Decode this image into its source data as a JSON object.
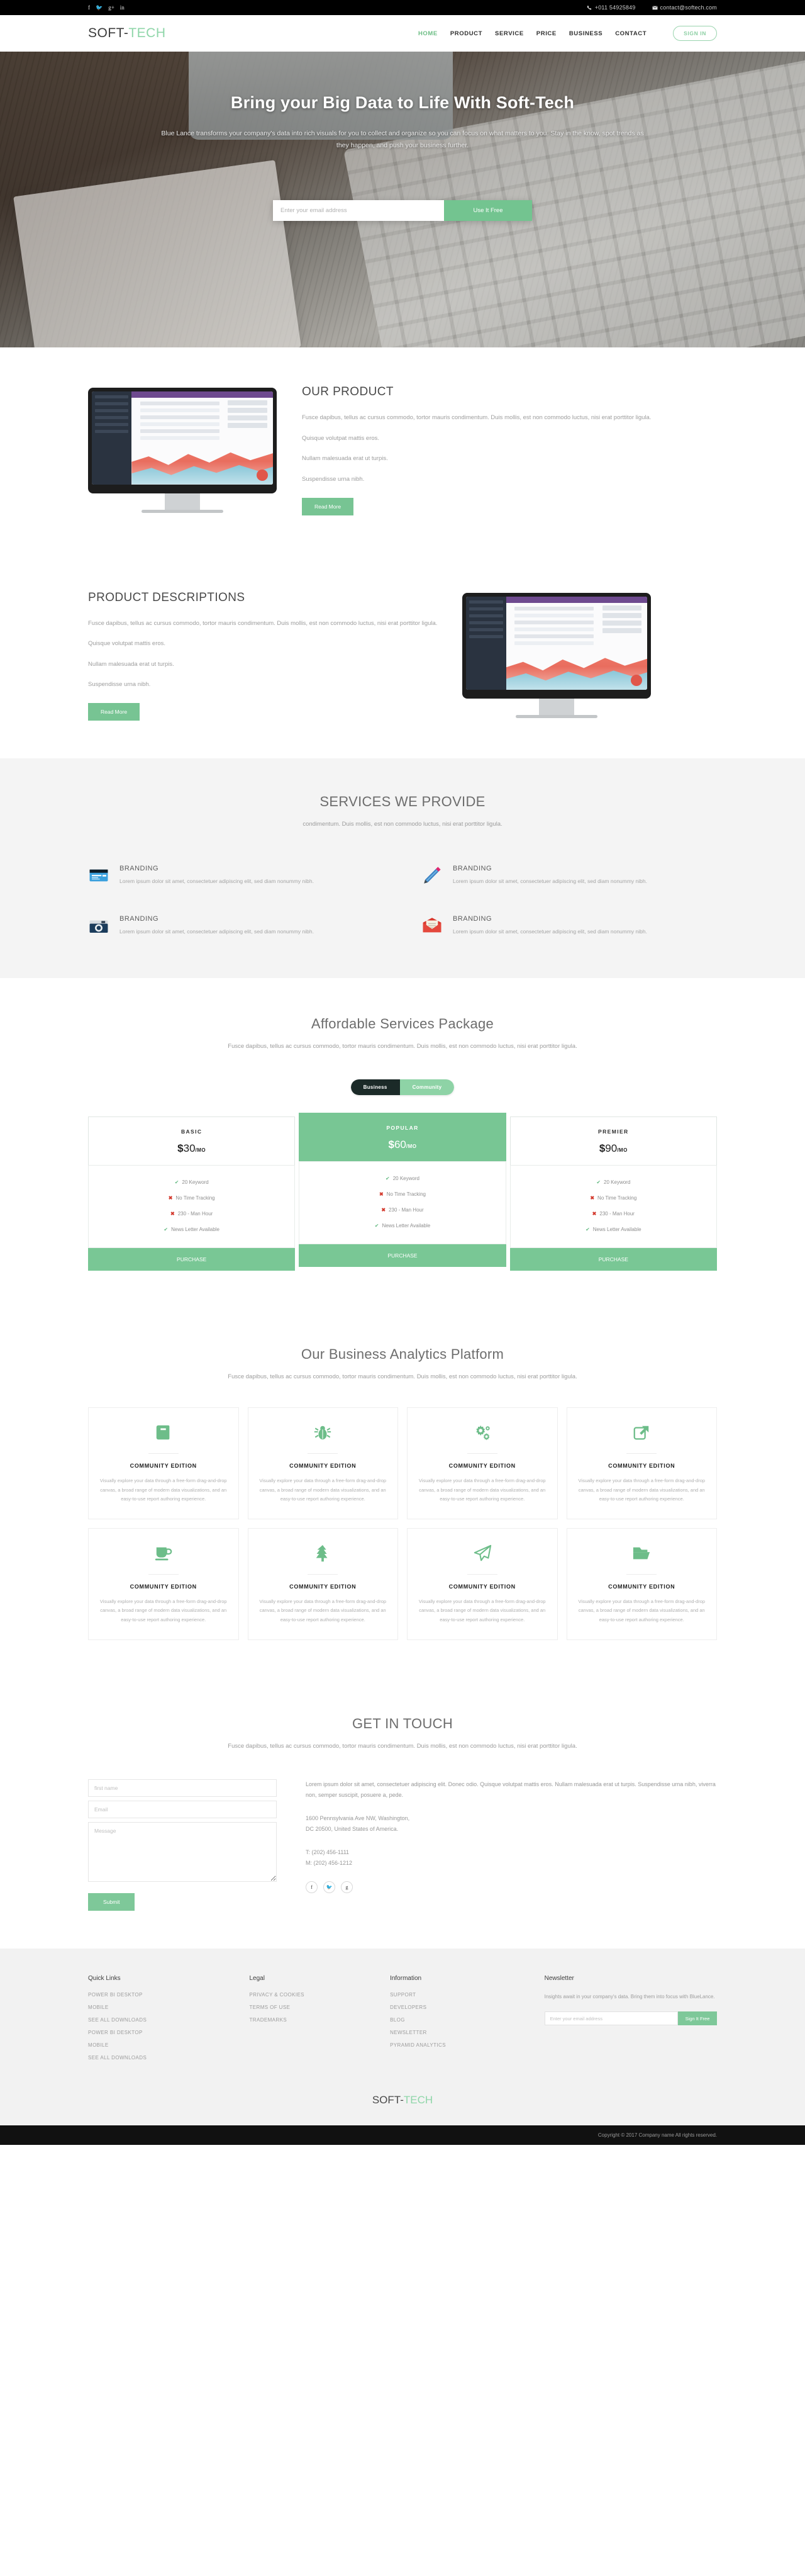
{
  "topbar": {
    "social": [
      {
        "name": "facebook-icon",
        "glyph": "f"
      },
      {
        "name": "twitter-icon",
        "glyph": "✉"
      },
      {
        "name": "google-plus-icon",
        "glyph": "g+"
      },
      {
        "name": "linkedin-icon",
        "glyph": "in"
      }
    ],
    "phone": "+011 54925849",
    "email": "contact@softech.com"
  },
  "nav": {
    "logo_main": "SOFT-",
    "logo_accent": "TECH",
    "links": [
      {
        "label": "HOME",
        "active": true
      },
      {
        "label": "PRODUCT",
        "active": false
      },
      {
        "label": "SERVICE",
        "active": false
      },
      {
        "label": "PRICE",
        "active": false
      },
      {
        "label": "BUSINESS",
        "active": false
      },
      {
        "label": "CONTACT",
        "active": false
      }
    ],
    "signin_label": "SIGN IN"
  },
  "hero": {
    "heading": "Bring your Big Data to Life With Soft-Tech",
    "paragraph": "Blue Lance transforms your company's data into rich visuals for you to collect and organize so you can focus on what matters to you. Stay in the know, spot trends as they happen, and push your business further.",
    "email_placeholder": "Enter your email address",
    "email_value": "",
    "cta_label": "Use It Free"
  },
  "product": {
    "title": "OUR PRODUCT",
    "paragraphs": [
      "Fusce dapibus, tellus ac cursus commodo, tortor mauris condimentum. Duis mollis, est non commodo luctus, nisi erat porttitor ligula.",
      "Quisque volutpat mattis eros.",
      "Nullam malesuada erat ut turpis.",
      "Suspendisse urna nibh."
    ],
    "button_label": "Read More"
  },
  "product_desc": {
    "title": "PRODUCT DESCRIPTIONS",
    "paragraphs": [
      "Fusce dapibus, tellus ac cursus commodo, tortor mauris condimentum. Duis mollis, est non commodo luctus, nisi erat porttitor ligula.",
      "Quisque volutpat mattis eros.",
      "Nullam malesuada erat ut turpis.",
      "Suspendisse urna nibh."
    ],
    "button_label": "Read More"
  },
  "services": {
    "title": "SERVICES WE PROVIDE",
    "subtitle": "condimentum. Duis mollis, est non commodo luctus, nisi erat porttitor ligula.",
    "items": [
      {
        "icon": "credit-card-icon",
        "title": "BRANDING",
        "text": "Lorem ipsum dolor sit amet, consectetuer adipiscing elit, sed diam nonummy nibh."
      },
      {
        "icon": "pencil-icon",
        "title": "BRANDING",
        "text": "Lorem ipsum dolor sit amet, consectetuer adipiscing elit, sed diam nonummy nibh."
      },
      {
        "icon": "camera-icon",
        "title": "BRANDING",
        "text": "Lorem ipsum dolor sit amet, consectetuer adipiscing elit, sed diam nonummy nibh."
      },
      {
        "icon": "envelope-icon",
        "title": "BRANDING",
        "text": "Lorem ipsum dolor sit amet, consectetuer adipiscing elit, sed diam nonummy nibh."
      }
    ]
  },
  "pricing": {
    "title": "Affordable Services Package",
    "subtitle": "Fusce dapibus, tellus ac cursus commodo, tortor mauris condimentum. Duis mollis, est non commodo luctus, nisi erat porttitor ligula.",
    "toggle": {
      "active": "Business",
      "inactive": "Community"
    },
    "accent_color": "#79c795",
    "plans": [
      {
        "name": "BASIC",
        "currency": "$",
        "amount": "30",
        "period": "/MO",
        "featured": false,
        "features": [
          {
            "ok": true,
            "label": "20 Keyword"
          },
          {
            "ok": false,
            "label": "No Time Tracking"
          },
          {
            "ok": false,
            "label": "230 - Man Hour"
          },
          {
            "ok": true,
            "label": "News Letter Available"
          }
        ],
        "cta": "PURCHASE"
      },
      {
        "name": "POPULAR",
        "currency": "$",
        "amount": "60",
        "period": "/MO",
        "featured": true,
        "features": [
          {
            "ok": true,
            "label": "20 Keyword"
          },
          {
            "ok": false,
            "label": "No Time Tracking"
          },
          {
            "ok": false,
            "label": "230 - Man Hour"
          },
          {
            "ok": true,
            "label": "News Letter Available"
          }
        ],
        "cta": "PURCHASE"
      },
      {
        "name": "PREMIER",
        "currency": "$",
        "amount": "90",
        "period": "/MO",
        "featured": false,
        "features": [
          {
            "ok": true,
            "label": "20 Keyword"
          },
          {
            "ok": false,
            "label": "No Time Tracking"
          },
          {
            "ok": false,
            "label": "230 - Man Hour"
          },
          {
            "ok": true,
            "label": "News Letter Available"
          }
        ],
        "cta": "PURCHASE"
      }
    ]
  },
  "analytics": {
    "title": "Our Business Analytics Platform",
    "subtitle": "Fusce dapibus, tellus ac cursus commodo, tortor mauris condimentum. Duis mollis, est non commodo luctus, nisi erat porttitor ligula.",
    "card_title": "COMMUNITY EDITION",
    "card_text": "Visually explore your data through a free-form drag-and-drop canvas, a broad range of modern data visualizations, and an easy-to-use report authoring experience.",
    "icons": [
      "book-icon",
      "bug-icon",
      "gears-icon",
      "external-link-icon",
      "coffee-cup-icon",
      "tree-icon",
      "paper-plane-icon",
      "folder-open-icon"
    ]
  },
  "contact": {
    "title": "GET IN TOUCH",
    "subtitle": "Fusce dapibus, tellus ac cursus commodo, tortor mauris condimentum. Duis mollis, est non commodo luctus, nisi erat porttitor ligula.",
    "form": {
      "name_placeholder": "first name",
      "name_value": "",
      "email_placeholder": "Email",
      "email_value": "",
      "message_placeholder": "Message",
      "message_value": "",
      "submit_label": "Submit"
    },
    "info_text": "Lorem ipsum dolor sit amet, consectetuer adipiscing elit. Donec odio. Quisque volutpat mattis eros. Nullam malesuada erat ut turpis. Suspendisse urna nibh, viverra non, semper suscipit, posuere a, pede.",
    "address_line1": "1600 Pennsylvania Ave NW, Washington,",
    "address_line2": "DC 20500, United States of America.",
    "tel": "T: (202) 456-1111",
    "mob": "M: (202) 456-1212",
    "social": [
      {
        "name": "facebook-icon",
        "glyph": "f"
      },
      {
        "name": "twitter-icon",
        "glyph": "✉"
      },
      {
        "name": "google-plus-icon",
        "glyph": "g"
      }
    ]
  },
  "footer": {
    "columns": [
      {
        "heading": "Quick Links",
        "links": [
          "POWER BI DESKTOP",
          "MOBILE",
          "SEE ALL DOWNLOADS",
          "POWER BI DESKTOP",
          "MOBILE",
          "SEE ALL DOWNLOADS"
        ]
      },
      {
        "heading": "Legal",
        "links": [
          "PRIVACY & COOKIES",
          "TERMS OF USE",
          "TRADEMARKS"
        ]
      },
      {
        "heading": "Information",
        "links": [
          "SUPPORT",
          "DEVELOPERS",
          "BLOG",
          "NEWSLETTER",
          "PYRAMID ANALYTICS"
        ]
      }
    ],
    "newsletter": {
      "heading": "Newsletter",
      "text": "Insights await in your company's data. Bring them into focus with BlueLance.",
      "placeholder": "Enter your email address",
      "value": "",
      "button_label": "Sign It Free"
    },
    "logo_main": "SOFT-",
    "logo_accent": "TECH",
    "copyright": "Copyright © 2017 Company name All rights reserved."
  }
}
